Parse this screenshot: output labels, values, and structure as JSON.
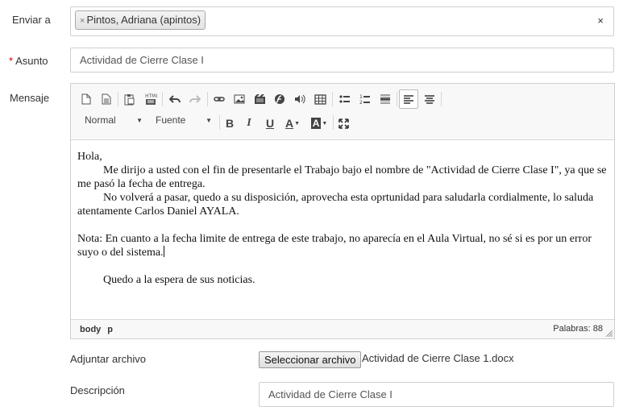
{
  "labels": {
    "to": "Enviar a",
    "required_mark": "*",
    "subject": "Asunto",
    "message": "Mensaje",
    "attach": "Adjuntar archivo",
    "description": "Descripción"
  },
  "recipients": {
    "chips": [
      {
        "remove": "×",
        "label": "Pintos, Adriana (apintos)"
      }
    ],
    "clear": "×"
  },
  "subject_value": "Actividad de Cierre Clase I",
  "editor": {
    "toolbar": {
      "format_combo": "Normal",
      "font_combo": "Fuente",
      "bold": "B",
      "italic": "I",
      "underline": "U",
      "text_color": "A",
      "bg_color": "A",
      "icons": [
        "new-page-icon",
        "templates-icon",
        "paste-text-icon",
        "paste-word-icon",
        "undo-icon",
        "redo-icon",
        "link-icon",
        "image-icon",
        "video-icon",
        "flash-icon",
        "audio-icon",
        "table-icon",
        "bulleted-list-icon",
        "numbered-list-icon",
        "horizontal-rule-icon",
        "align-left-icon",
        "align-center-icon",
        "maximize-icon"
      ]
    },
    "body": {
      "greeting": "Hola,",
      "p1": "Me dirijo a usted con el fin de presentarle el Trabajo bajo el nombre de \"Actividad de Cierre Clase I\", ya que se me pasó la fecha de entrega.",
      "p2": "No volverá a pasar, quedo a su disposición, aprovecha esta oprtunidad para saludarla cordialmente, lo saluda atentamente Carlos Daniel AYALA.",
      "p3": "Nota: En cuanto a la fecha limite de entrega de este trabajo, no aparecía en el Aula Virtual, no sé si es por un error suyo o del sistema.",
      "p4": "Quedo a la espera de sus noticias."
    },
    "status": {
      "path": [
        "body",
        "p"
      ],
      "word_count": "Palabras: 88"
    }
  },
  "attachment": {
    "button": "Seleccionar archivo",
    "file_name": "Actividad de Cierre Clase 1.docx"
  },
  "description_value": "Actividad de Cierre Clase I"
}
